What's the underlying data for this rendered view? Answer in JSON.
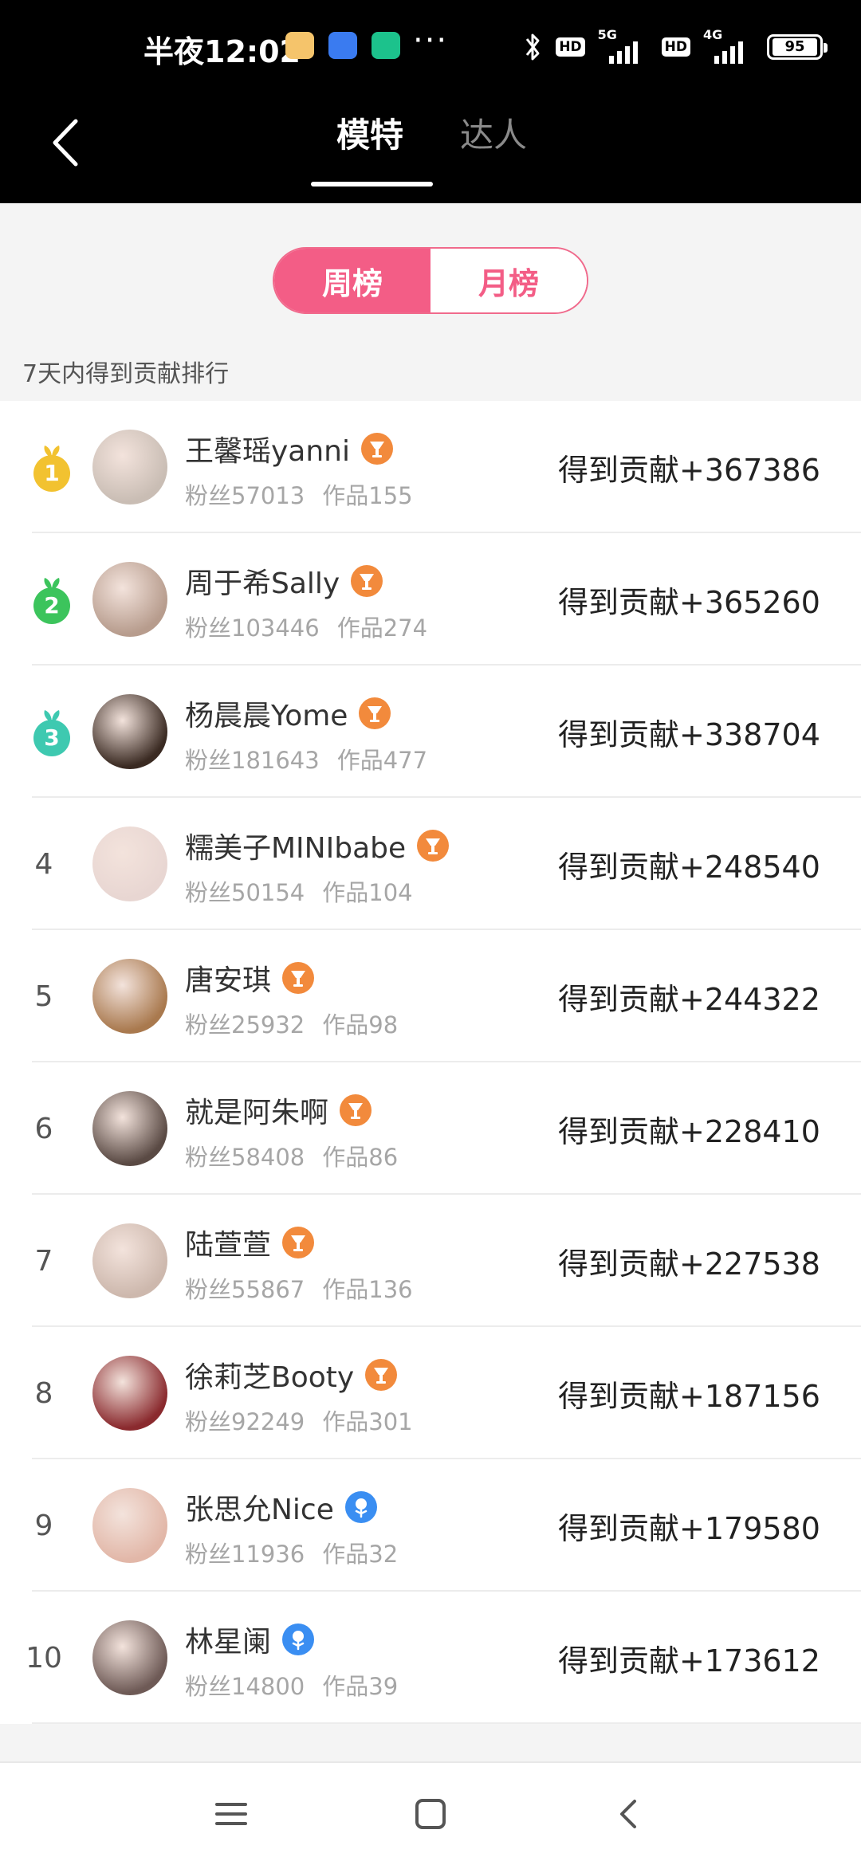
{
  "status_bar": {
    "time": "半夜12:02",
    "more": "···",
    "hd1": "HD",
    "net1": "5G",
    "hd2": "HD",
    "net2": "4G",
    "battery": "95"
  },
  "header": {
    "tabs": [
      {
        "label": "模特",
        "active": true
      },
      {
        "label": "达人",
        "active": false
      }
    ]
  },
  "period": {
    "options": [
      {
        "label": "周榜",
        "active": true
      },
      {
        "label": "月榜",
        "active": false
      }
    ]
  },
  "subtitle": "7天内得到贡献排行",
  "medal_colors": {
    "1": "#f2c230",
    "2": "#3cc45c",
    "3": "#3ec9b0"
  },
  "badge_colors": {
    "orange": "#f28a3c",
    "blue": "#3a8ef2"
  },
  "rankings": [
    {
      "rank": "1",
      "name": "王馨瑶yanni",
      "fans": "粉丝57013",
      "works": "作品155",
      "contribution": "得到贡献+367386",
      "badge": "orange",
      "avatar_color": "#c9bdb4"
    },
    {
      "rank": "2",
      "name": "周于希Sally",
      "fans": "粉丝103446",
      "works": "作品274",
      "contribution": "得到贡献+365260",
      "badge": "orange",
      "avatar_color": "#b79c8d"
    },
    {
      "rank": "3",
      "name": "杨晨晨Yome",
      "fans": "粉丝181643",
      "works": "作品477",
      "contribution": "得到贡献+338704",
      "badge": "orange",
      "avatar_color": "#3a2a22"
    },
    {
      "rank": "4",
      "name": "糯美子MINIbabe",
      "fans": "粉丝50154",
      "works": "作品104",
      "contribution": "得到贡献+248540",
      "badge": "orange",
      "avatar_color": "#e8d6d2"
    },
    {
      "rank": "5",
      "name": "唐安琪",
      "fans": "粉丝25932",
      "works": "作品98",
      "contribution": "得到贡献+244322",
      "badge": "orange",
      "avatar_color": "#a9794e"
    },
    {
      "rank": "6",
      "name": "就是阿朱啊",
      "fans": "粉丝58408",
      "works": "作品86",
      "contribution": "得到贡献+228410",
      "badge": "orange",
      "avatar_color": "#5a4a44"
    },
    {
      "rank": "7",
      "name": "陆萱萱",
      "fans": "粉丝55867",
      "works": "作品136",
      "contribution": "得到贡献+227538",
      "badge": "orange",
      "avatar_color": "#cdb8ad"
    },
    {
      "rank": "8",
      "name": "徐莉芝Booty",
      "fans": "粉丝92249",
      "works": "作品301",
      "contribution": "得到贡献+187156",
      "badge": "orange",
      "avatar_color": "#8a2a2e"
    },
    {
      "rank": "9",
      "name": "张思允Nice",
      "fans": "粉丝11936",
      "works": "作品32",
      "contribution": "得到贡献+179580",
      "badge": "blue",
      "avatar_color": "#e2b7a8"
    },
    {
      "rank": "10",
      "name": "林星阑",
      "fans": "粉丝14800",
      "works": "作品39",
      "contribution": "得到贡献+173612",
      "badge": "blue",
      "avatar_color": "#6e5a56"
    }
  ],
  "nav": {
    "icons": [
      "menu-icon",
      "home-square-icon",
      "back-chevron-icon"
    ]
  }
}
